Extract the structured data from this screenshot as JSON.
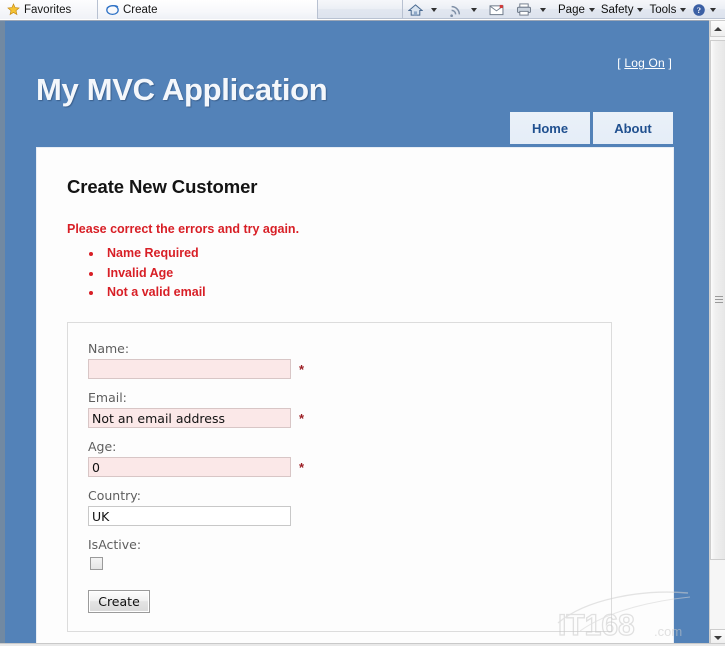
{
  "browser": {
    "favorites_label": "Favorites",
    "favorites_icon": "star-icon",
    "tab_label": "Create",
    "tab_icon": "internet-explorer-icon",
    "commands": [
      {
        "id": "home",
        "icon": "home-icon",
        "label": "",
        "has_caret": true
      },
      {
        "id": "feeds",
        "icon": "rss-feed-icon",
        "label": "",
        "has_caret": true
      },
      {
        "id": "mail",
        "icon": "mail-icon",
        "label": "",
        "has_caret": false
      },
      {
        "id": "print",
        "icon": "printer-icon",
        "label": "",
        "has_caret": true
      },
      {
        "id": "page",
        "icon": "",
        "label": "Page",
        "has_caret": true
      },
      {
        "id": "safety",
        "icon": "",
        "label": "Safety",
        "has_caret": true
      },
      {
        "id": "tools",
        "icon": "",
        "label": "Tools",
        "has_caret": true
      },
      {
        "id": "help",
        "icon": "help-icon",
        "label": "",
        "has_caret": true
      }
    ]
  },
  "site": {
    "title": "My MVC Application",
    "login_prefix": "[",
    "login_label": "Log On",
    "login_suffix": "]",
    "menu": [
      {
        "label": "Home"
      },
      {
        "label": "About"
      }
    ],
    "header_color": "#5382b8",
    "menu_text_color": "#20508f"
  },
  "main": {
    "page_title": "Create New Customer",
    "validation": {
      "summary": "Please correct the errors and try again.",
      "color": "#d81f26",
      "errors": [
        "Name Required",
        "Invalid Age",
        "Not a valid email"
      ]
    },
    "form": {
      "required_marker": "*",
      "fields": [
        {
          "id": "name",
          "label": "Name:",
          "value": "",
          "placeholder": "",
          "error": true,
          "required": true,
          "type": "text"
        },
        {
          "id": "email",
          "label": "Email:",
          "value": "Not an email address",
          "placeholder": "",
          "error": true,
          "required": true,
          "type": "text"
        },
        {
          "id": "age",
          "label": "Age:",
          "value": "0",
          "placeholder": "",
          "error": true,
          "required": true,
          "type": "text"
        },
        {
          "id": "country",
          "label": "Country:",
          "value": "UK",
          "placeholder": "",
          "error": false,
          "required": false,
          "type": "text"
        },
        {
          "id": "isactive",
          "label": "IsActive:",
          "value": "",
          "placeholder": "",
          "error": false,
          "required": false,
          "type": "checkbox",
          "checked": false
        }
      ],
      "submit_label": "Create"
    }
  },
  "watermark": {
    "text": "IT168",
    "suffix": ".com"
  },
  "scrollbar": {
    "up_icon": "scroll-up-arrow-icon",
    "down_icon": "scroll-down-arrow-icon"
  }
}
